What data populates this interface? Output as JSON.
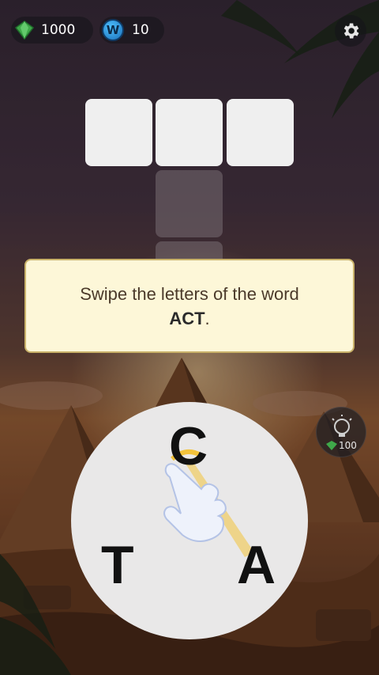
{
  "currency": {
    "gems": "1000",
    "word_tokens": "10",
    "word_token_symbol": "W"
  },
  "tutorial": {
    "text_before": "Swipe the letters of the word",
    "word": "ACT",
    "text_after": "."
  },
  "hint": {
    "cost": "100"
  },
  "wheel": {
    "letters": [
      "C",
      "T",
      "A"
    ]
  },
  "colors": {
    "gem": "#3fa84a",
    "highlight": "#f2c23a",
    "tile_empty": "#efefef"
  },
  "icons": [
    "gem-icon",
    "w-token-icon",
    "gear-icon",
    "lightbulb-icon",
    "hand-pointer-icon"
  ]
}
